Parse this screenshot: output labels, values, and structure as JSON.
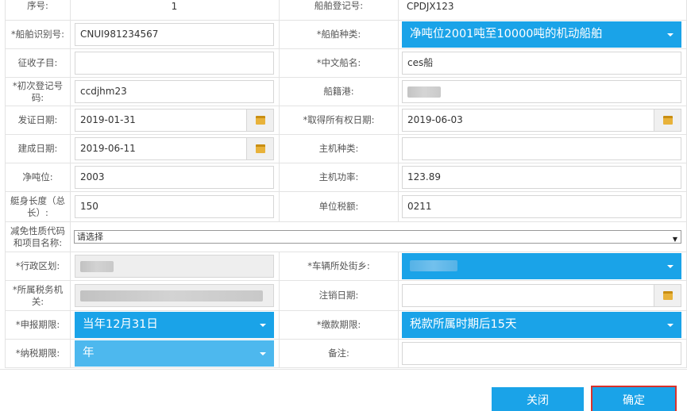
{
  "form": {
    "row0": {
      "label_left": "序号:",
      "value_left": "1",
      "label_right": "船舶登记号:",
      "value_right": "CPDJX123"
    },
    "row1": {
      "label_left": "*船舶识别号:",
      "value_left": "CNUI981234567",
      "label_right": "*船舶种类:",
      "value_right": "净吨位2001吨至10000吨的机动船舶"
    },
    "row2": {
      "label_left": "征收子目:",
      "value_left": "",
      "label_right": "*中文船名:",
      "value_right": "ces船"
    },
    "row3": {
      "label_left": "*初次登记号码:",
      "value_left": "ccdjhm23",
      "label_right": "船籍港:",
      "value_right": ""
    },
    "row4": {
      "label_left": "发证日期:",
      "value_left": "2019-01-31",
      "label_right": "*取得所有权日期:",
      "value_right": "2019-06-03"
    },
    "row5": {
      "label_left": "建成日期:",
      "value_left": "2019-06-11",
      "label_right": "主机种类:",
      "value_right": ""
    },
    "row6": {
      "label_left": "净吨位:",
      "value_left": "2003",
      "label_right": "主机功率:",
      "value_right": "123.89"
    },
    "row7": {
      "label_left": "艇身长度（总长）:",
      "value_left": "150",
      "label_right": "单位税额:",
      "value_right": "0211"
    },
    "row8": {
      "label_left": "减免性质代码和项目名称:",
      "value": "请选择"
    },
    "row9": {
      "label_left": "*行政区划:",
      "value_left": "",
      "label_right": "*车辆所处街乡:",
      "value_right": ""
    },
    "row10": {
      "label_left": "*所属税务机关:",
      "value_left": "",
      "label_right": "注销日期:",
      "value_right": ""
    },
    "row11": {
      "label_left": "*申报期限:",
      "value_left": "当年12月31日",
      "label_right": "*缴款期限:",
      "value_right": "税款所属时期后15天"
    },
    "row12": {
      "label_left": "*纳税期限:",
      "value_left": "年",
      "label_right": "备注:",
      "value_right": ""
    }
  },
  "footer": {
    "close_label": "关闭",
    "confirm_label": "确定"
  },
  "colors": {
    "accent": "#1aa3e8",
    "accent_light": "#4db8ee",
    "highlight": "#d9322b",
    "calendar": "#e8b23a"
  },
  "icons": {
    "date_picker": "calendar-icon",
    "dropdown": "chevron-down-icon"
  }
}
